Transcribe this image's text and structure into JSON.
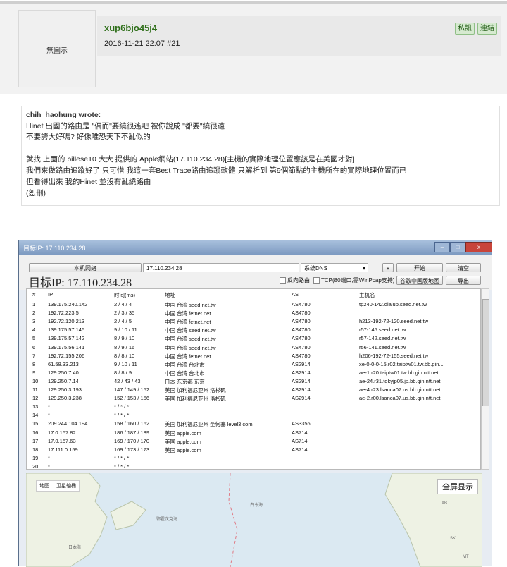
{
  "post": {
    "avatar_text": "無圖示",
    "username": "xup6bjo45j4",
    "datetime": "2016-11-21 22:07",
    "floor": "#21",
    "actions": {
      "message": "私訊",
      "link": "連結"
    }
  },
  "content": {
    "quote_author": "chih_haohung wrote:",
    "quote_lines": [
      "Hinet 出國的路由是 \"偶而\"要繞很遙吧 被你說成 \"都要\"繞很遠",
      "不要誇大好嗎? 好像唯恐天下不亂似的"
    ],
    "body_lines": [
      "就找 上面的 billese10 大大 提供的 Apple網站(17.110.234.28)[主機的實際地理位置應該是在美國才對]",
      "我們來做路由追蹤好了 只可惜 我這一套Best Trace路由追蹤軟體 只解析到 第9個節點的主機所在的實際地理位置而已",
      "但看得出來 我的Hinet 並沒有亂繞路由",
      "(恕刪)"
    ]
  },
  "window": {
    "title": "目标IP: 17.110.234.28",
    "controls": {
      "minimize": "–",
      "maximize": "□",
      "close": "x"
    },
    "toolbar": {
      "local_network": "本机网络",
      "target_input": "17.110.234.28",
      "dns_select": "系统DNS",
      "add_button": "+",
      "start_button": "开始",
      "clear_button": "清空",
      "reverse_dns": "反向路由",
      "tcp_option": "TCP(80端口,需WinPcap支持)",
      "google_map": "谷歌中国版地图",
      "export_button": "导出",
      "big_ip": "目标IP: 17.110.234.28"
    },
    "table": {
      "headers": [
        "#",
        "IP",
        "时间(ms)",
        "地址",
        "AS",
        "主机名"
      ],
      "rows": [
        [
          "1",
          "139.175.240.142",
          "2 / 4 / 4",
          "中国 台湾 seed.net.tw",
          "AS4780",
          "tp240-142.dialup.seed.net.tw"
        ],
        [
          "2",
          "192.72.223.5",
          "2 / 3 / 35",
          "中国 台湾 fetnet.net",
          "AS4780",
          ""
        ],
        [
          "3",
          "192.72.120.213",
          "2 / 4 / 5",
          "中国 台湾 fetnet.net",
          "AS4780",
          "h213-192-72-120.seed.net.tw"
        ],
        [
          "4",
          "139.175.57.145",
          "9 / 10 / 11",
          "中国 台湾 seed.net.tw",
          "AS4780",
          "r57-145.seed.net.tw"
        ],
        [
          "5",
          "139.175.57.142",
          "8 / 9 / 10",
          "中国 台湾 seed.net.tw",
          "AS4780",
          "r57-142.seed.net.tw"
        ],
        [
          "6",
          "139.175.56.141",
          "8 / 9 / 16",
          "中国 台湾 seed.net.tw",
          "AS4780",
          "r56-141.seed.net.tw"
        ],
        [
          "7",
          "192.72.155.206",
          "8 / 8 / 10",
          "中国 台湾 fetnet.net",
          "AS4780",
          "h206-192-72-155.seed.net.tw"
        ],
        [
          "8",
          "61.58.33.213",
          "9 / 10 / 11",
          "中国 台湾 台北市",
          "AS2914",
          "xe-0-0-0-15.r02.taiptw01.tw.bb.gin..."
        ],
        [
          "9",
          "129.250.7.40",
          "8 / 8 / 9",
          "中国 台湾 台北市",
          "AS2914",
          "ae-1.r20.taiptw01.tw.bb.gin.ntt.net"
        ],
        [
          "10",
          "129.250.7.14",
          "42 / 43 / 43",
          "日本 东京都 东京",
          "AS2914",
          "ae-24.r31.tokyjp05.jp.bb.gin.ntt.net"
        ],
        [
          "11",
          "129.250.3.193",
          "147 / 149 / 152",
          "美国 加利福尼亚州 洛杉矶",
          "AS2914",
          "ae-4.r23.lsanca07.us.bb.gin.ntt.net"
        ],
        [
          "12",
          "129.250.3.238",
          "152 / 153 / 156",
          "美国 加利福尼亚州 洛杉矶",
          "AS2914",
          "ae-2.r00.lsanca07.us.bb.gin.ntt.net"
        ],
        [
          "13",
          "*",
          "* / * / *",
          "",
          "",
          ""
        ],
        [
          "14",
          "*",
          "* / * / *",
          "",
          "",
          ""
        ],
        [
          "15",
          "209.244.104.194",
          "158 / 160 / 162",
          "美国 加利福尼亚州 圣何塞 level3.com",
          "AS3356",
          ""
        ],
        [
          "16",
          "17.0.157.82",
          "186 / 187 / 189",
          "美国 apple.com",
          "AS714",
          ""
        ],
        [
          "17",
          "17.0.157.63",
          "169 / 170 / 170",
          "美国 apple.com",
          "AS714",
          ""
        ],
        [
          "18",
          "17.111.0.159",
          "169 / 173 / 173",
          "美国 apple.com",
          "AS714",
          ""
        ],
        [
          "19",
          "*",
          "* / * / *",
          "",
          "",
          ""
        ],
        [
          "20",
          "*",
          "* / * / *",
          "",
          "",
          ""
        ]
      ]
    },
    "map": {
      "tab_map": "地图",
      "tab_satellite": "卫星轴桶",
      "fullscreen": "全屏显示",
      "labels": [
        "日本海",
        "鄂霍次克海",
        "白令海",
        "AB",
        "SK",
        "MT"
      ]
    }
  }
}
